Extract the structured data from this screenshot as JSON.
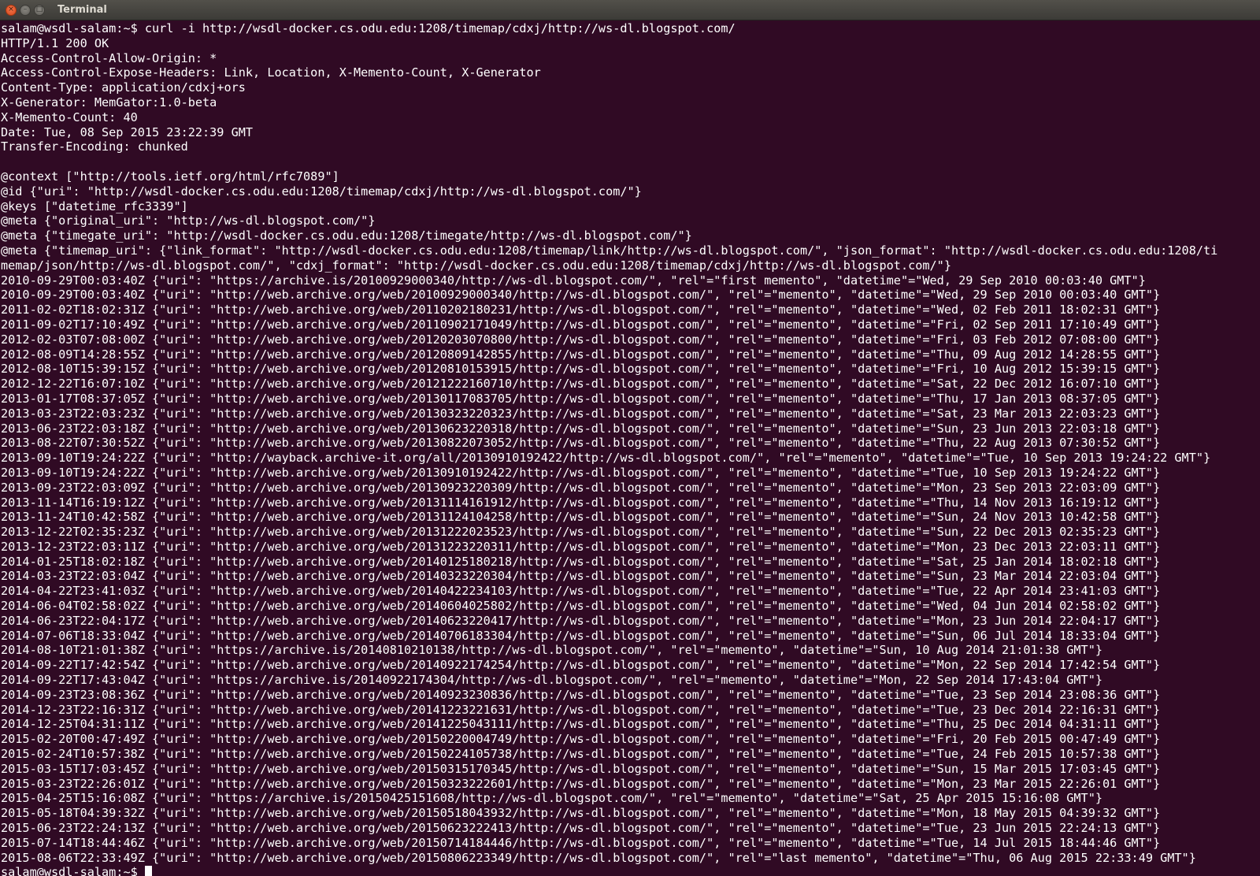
{
  "window": {
    "title": "Terminal",
    "buttons": {
      "close": "×",
      "minimize": "–",
      "maximize": "□"
    }
  },
  "terminal": {
    "lines": [
      "salam@wsdl-salam:~$ curl -i http://wsdl-docker.cs.odu.edu:1208/timemap/cdxj/http://ws-dl.blogspot.com/",
      "HTTP/1.1 200 OK",
      "Access-Control-Allow-Origin: *",
      "Access-Control-Expose-Headers: Link, Location, X-Memento-Count, X-Generator",
      "Content-Type: application/cdxj+ors",
      "X-Generator: MemGator:1.0-beta",
      "X-Memento-Count: 40",
      "Date: Tue, 08 Sep 2015 23:22:39 GMT",
      "Transfer-Encoding: chunked",
      "",
      "@context [\"http://tools.ietf.org/html/rfc7089\"]",
      "@id {\"uri\": \"http://wsdl-docker.cs.odu.edu:1208/timemap/cdxj/http://ws-dl.blogspot.com/\"}",
      "@keys [\"datetime_rfc3339\"]",
      "@meta {\"original_uri\": \"http://ws-dl.blogspot.com/\"}",
      "@meta {\"timegate_uri\": \"http://wsdl-docker.cs.odu.edu:1208/timegate/http://ws-dl.blogspot.com/\"}",
      "@meta {\"timemap_uri\": {\"link_format\": \"http://wsdl-docker.cs.odu.edu:1208/timemap/link/http://ws-dl.blogspot.com/\", \"json_format\": \"http://wsdl-docker.cs.odu.edu:1208/ti",
      "memap/json/http://ws-dl.blogspot.com/\", \"cdxj_format\": \"http://wsdl-docker.cs.odu.edu:1208/timemap/cdxj/http://ws-dl.blogspot.com/\"}",
      "2010-09-29T00:03:40Z {\"uri\": \"https://archive.is/20100929000340/http://ws-dl.blogspot.com/\", \"rel\"=\"first memento\", \"datetime\"=\"Wed, 29 Sep 2010 00:03:40 GMT\"}",
      "2010-09-29T00:03:40Z {\"uri\": \"http://web.archive.org/web/20100929000340/http://ws-dl.blogspot.com/\", \"rel\"=\"memento\", \"datetime\"=\"Wed, 29 Sep 2010 00:03:40 GMT\"}",
      "2011-02-02T18:02:31Z {\"uri\": \"http://web.archive.org/web/20110202180231/http://ws-dl.blogspot.com/\", \"rel\"=\"memento\", \"datetime\"=\"Wed, 02 Feb 2011 18:02:31 GMT\"}",
      "2011-09-02T17:10:49Z {\"uri\": \"http://web.archive.org/web/20110902171049/http://ws-dl.blogspot.com/\", \"rel\"=\"memento\", \"datetime\"=\"Fri, 02 Sep 2011 17:10:49 GMT\"}",
      "2012-02-03T07:08:00Z {\"uri\": \"http://web.archive.org/web/20120203070800/http://ws-dl.blogspot.com/\", \"rel\"=\"memento\", \"datetime\"=\"Fri, 03 Feb 2012 07:08:00 GMT\"}",
      "2012-08-09T14:28:55Z {\"uri\": \"http://web.archive.org/web/20120809142855/http://ws-dl.blogspot.com/\", \"rel\"=\"memento\", \"datetime\"=\"Thu, 09 Aug 2012 14:28:55 GMT\"}",
      "2012-08-10T15:39:15Z {\"uri\": \"http://web.archive.org/web/20120810153915/http://ws-dl.blogspot.com/\", \"rel\"=\"memento\", \"datetime\"=\"Fri, 10 Aug 2012 15:39:15 GMT\"}",
      "2012-12-22T16:07:10Z {\"uri\": \"http://web.archive.org/web/20121222160710/http://ws-dl.blogspot.com/\", \"rel\"=\"memento\", \"datetime\"=\"Sat, 22 Dec 2012 16:07:10 GMT\"}",
      "2013-01-17T08:37:05Z {\"uri\": \"http://web.archive.org/web/20130117083705/http://ws-dl.blogspot.com/\", \"rel\"=\"memento\", \"datetime\"=\"Thu, 17 Jan 2013 08:37:05 GMT\"}",
      "2013-03-23T22:03:23Z {\"uri\": \"http://web.archive.org/web/20130323220323/http://ws-dl.blogspot.com/\", \"rel\"=\"memento\", \"datetime\"=\"Sat, 23 Mar 2013 22:03:23 GMT\"}",
      "2013-06-23T22:03:18Z {\"uri\": \"http://web.archive.org/web/20130623220318/http://ws-dl.blogspot.com/\", \"rel\"=\"memento\", \"datetime\"=\"Sun, 23 Jun 2013 22:03:18 GMT\"}",
      "2013-08-22T07:30:52Z {\"uri\": \"http://web.archive.org/web/20130822073052/http://ws-dl.blogspot.com/\", \"rel\"=\"memento\", \"datetime\"=\"Thu, 22 Aug 2013 07:30:52 GMT\"}",
      "2013-09-10T19:24:22Z {\"uri\": \"http://wayback.archive-it.org/all/20130910192422/http://ws-dl.blogspot.com/\", \"rel\"=\"memento\", \"datetime\"=\"Tue, 10 Sep 2013 19:24:22 GMT\"}",
      "2013-09-10T19:24:22Z {\"uri\": \"http://web.archive.org/web/20130910192422/http://ws-dl.blogspot.com/\", \"rel\"=\"memento\", \"datetime\"=\"Tue, 10 Sep 2013 19:24:22 GMT\"}",
      "2013-09-23T22:03:09Z {\"uri\": \"http://web.archive.org/web/20130923220309/http://ws-dl.blogspot.com/\", \"rel\"=\"memento\", \"datetime\"=\"Mon, 23 Sep 2013 22:03:09 GMT\"}",
      "2013-11-14T16:19:12Z {\"uri\": \"http://web.archive.org/web/20131114161912/http://ws-dl.blogspot.com/\", \"rel\"=\"memento\", \"datetime\"=\"Thu, 14 Nov 2013 16:19:12 GMT\"}",
      "2013-11-24T10:42:58Z {\"uri\": \"http://web.archive.org/web/20131124104258/http://ws-dl.blogspot.com/\", \"rel\"=\"memento\", \"datetime\"=\"Sun, 24 Nov 2013 10:42:58 GMT\"}",
      "2013-12-22T02:35:23Z {\"uri\": \"http://web.archive.org/web/20131222023523/http://ws-dl.blogspot.com/\", \"rel\"=\"memento\", \"datetime\"=\"Sun, 22 Dec 2013 02:35:23 GMT\"}",
      "2013-12-23T22:03:11Z {\"uri\": \"http://web.archive.org/web/20131223220311/http://ws-dl.blogspot.com/\", \"rel\"=\"memento\", \"datetime\"=\"Mon, 23 Dec 2013 22:03:11 GMT\"}",
      "2014-01-25T18:02:18Z {\"uri\": \"http://web.archive.org/web/20140125180218/http://ws-dl.blogspot.com/\", \"rel\"=\"memento\", \"datetime\"=\"Sat, 25 Jan 2014 18:02:18 GMT\"}",
      "2014-03-23T22:03:04Z {\"uri\": \"http://web.archive.org/web/20140323220304/http://ws-dl.blogspot.com/\", \"rel\"=\"memento\", \"datetime\"=\"Sun, 23 Mar 2014 22:03:04 GMT\"}",
      "2014-04-22T23:41:03Z {\"uri\": \"http://web.archive.org/web/20140422234103/http://ws-dl.blogspot.com/\", \"rel\"=\"memento\", \"datetime\"=\"Tue, 22 Apr 2014 23:41:03 GMT\"}",
      "2014-06-04T02:58:02Z {\"uri\": \"http://web.archive.org/web/20140604025802/http://ws-dl.blogspot.com/\", \"rel\"=\"memento\", \"datetime\"=\"Wed, 04 Jun 2014 02:58:02 GMT\"}",
      "2014-06-23T22:04:17Z {\"uri\": \"http://web.archive.org/web/20140623220417/http://ws-dl.blogspot.com/\", \"rel\"=\"memento\", \"datetime\"=\"Mon, 23 Jun 2014 22:04:17 GMT\"}",
      "2014-07-06T18:33:04Z {\"uri\": \"http://web.archive.org/web/20140706183304/http://ws-dl.blogspot.com/\", \"rel\"=\"memento\", \"datetime\"=\"Sun, 06 Jul 2014 18:33:04 GMT\"}",
      "2014-08-10T21:01:38Z {\"uri\": \"https://archive.is/20140810210138/http://ws-dl.blogspot.com/\", \"rel\"=\"memento\", \"datetime\"=\"Sun, 10 Aug 2014 21:01:38 GMT\"}",
      "2014-09-22T17:42:54Z {\"uri\": \"http://web.archive.org/web/20140922174254/http://ws-dl.blogspot.com/\", \"rel\"=\"memento\", \"datetime\"=\"Mon, 22 Sep 2014 17:42:54 GMT\"}",
      "2014-09-22T17:43:04Z {\"uri\": \"https://archive.is/20140922174304/http://ws-dl.blogspot.com/\", \"rel\"=\"memento\", \"datetime\"=\"Mon, 22 Sep 2014 17:43:04 GMT\"}",
      "2014-09-23T23:08:36Z {\"uri\": \"http://web.archive.org/web/20140923230836/http://ws-dl.blogspot.com/\", \"rel\"=\"memento\", \"datetime\"=\"Tue, 23 Sep 2014 23:08:36 GMT\"}",
      "2014-12-23T22:16:31Z {\"uri\": \"http://web.archive.org/web/20141223221631/http://ws-dl.blogspot.com/\", \"rel\"=\"memento\", \"datetime\"=\"Tue, 23 Dec 2014 22:16:31 GMT\"}",
      "2014-12-25T04:31:11Z {\"uri\": \"http://web.archive.org/web/20141225043111/http://ws-dl.blogspot.com/\", \"rel\"=\"memento\", \"datetime\"=\"Thu, 25 Dec 2014 04:31:11 GMT\"}",
      "2015-02-20T00:47:49Z {\"uri\": \"http://web.archive.org/web/20150220004749/http://ws-dl.blogspot.com/\", \"rel\"=\"memento\", \"datetime\"=\"Fri, 20 Feb 2015 00:47:49 GMT\"}",
      "2015-02-24T10:57:38Z {\"uri\": \"http://web.archive.org/web/20150224105738/http://ws-dl.blogspot.com/\", \"rel\"=\"memento\", \"datetime\"=\"Tue, 24 Feb 2015 10:57:38 GMT\"}",
      "2015-03-15T17:03:45Z {\"uri\": \"http://web.archive.org/web/20150315170345/http://ws-dl.blogspot.com/\", \"rel\"=\"memento\", \"datetime\"=\"Sun, 15 Mar 2015 17:03:45 GMT\"}",
      "2015-03-23T22:26:01Z {\"uri\": \"http://web.archive.org/web/20150323222601/http://ws-dl.blogspot.com/\", \"rel\"=\"memento\", \"datetime\"=\"Mon, 23 Mar 2015 22:26:01 GMT\"}",
      "2015-04-25T15:16:08Z {\"uri\": \"https://archive.is/20150425151608/http://ws-dl.blogspot.com/\", \"rel\"=\"memento\", \"datetime\"=\"Sat, 25 Apr 2015 15:16:08 GMT\"}",
      "2015-05-18T04:39:32Z {\"uri\": \"http://web.archive.org/web/20150518043932/http://ws-dl.blogspot.com/\", \"rel\"=\"memento\", \"datetime\"=\"Mon, 18 May 2015 04:39:32 GMT\"}",
      "2015-06-23T22:24:13Z {\"uri\": \"http://web.archive.org/web/20150623222413/http://ws-dl.blogspot.com/\", \"rel\"=\"memento\", \"datetime\"=\"Tue, 23 Jun 2015 22:24:13 GMT\"}",
      "2015-07-14T18:44:46Z {\"uri\": \"http://web.archive.org/web/20150714184446/http://ws-dl.blogspot.com/\", \"rel\"=\"memento\", \"datetime\"=\"Tue, 14 Jul 2015 18:44:46 GMT\"}",
      "2015-08-06T22:33:49Z {\"uri\": \"http://web.archive.org/web/20150806223349/http://ws-dl.blogspot.com/\", \"rel\"=\"last memento\", \"datetime\"=\"Thu, 06 Aug 2015 22:33:49 GMT\"}"
    ],
    "prompt": "salam@wsdl-salam:~$ "
  },
  "colors": {
    "background": "#300a24",
    "text": "#ffffff",
    "titlebar": "#3c3b37",
    "close_button": "#e25a2b"
  }
}
